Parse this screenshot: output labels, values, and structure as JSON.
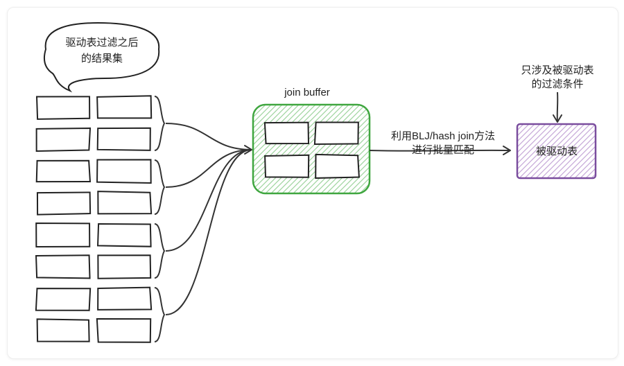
{
  "speech_bubble": {
    "line1": "驱动表过滤之后",
    "line2": "的结果集"
  },
  "join_buffer_label": "join buffer",
  "arrow1": {
    "line1": "利用BLJ/hash join方法",
    "line2": "进行批量匹配"
  },
  "driven_table_label": "被驱动表",
  "filter_condition": {
    "line1": "只涉及被驱动表",
    "line2": "的过滤条件"
  },
  "counts": {
    "result_rows": 8,
    "result_cols": 2,
    "buffer_rows": 2,
    "buffer_cols": 2
  }
}
